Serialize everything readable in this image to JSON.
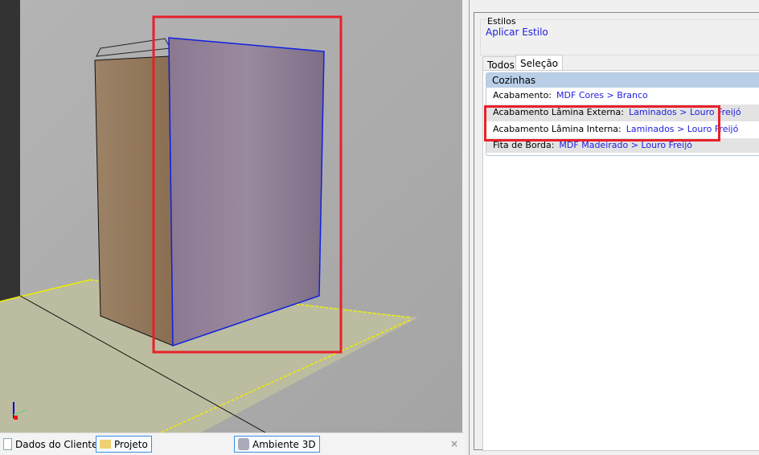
{
  "viewport": {
    "tabs": [
      {
        "label": "Dados do Cliente",
        "icon": "document-icon"
      },
      {
        "label": "Projeto",
        "icon": "folder-icon"
      },
      {
        "label": "Ambiente 3D",
        "icon": "3d-environment-icon"
      }
    ],
    "close": "×"
  },
  "panel": {
    "styles_group": {
      "title": "Estilos",
      "apply_link": "Aplicar Estilo"
    },
    "tabs": [
      "Todos",
      "Seleção"
    ],
    "group_header": "Cozinhas",
    "rows": [
      {
        "label": "Acabamento:",
        "value": "MDF Cores > Branco"
      },
      {
        "label": "Acabamento Lâmina Externa:",
        "value": "Laminados > Louro Freijó"
      },
      {
        "label": "Acabamento Lâmina Interna:",
        "value": "Laminados > Louro Freijó"
      },
      {
        "label": "Fita de Borda:",
        "value": "MDF Madeirado > Louro Freijó"
      }
    ]
  },
  "colors": {
    "highlight": "#e8202a",
    "link": "#2020e0",
    "cabinet_front": "#8a7a90",
    "cabinet_side": "#9a7d60"
  }
}
